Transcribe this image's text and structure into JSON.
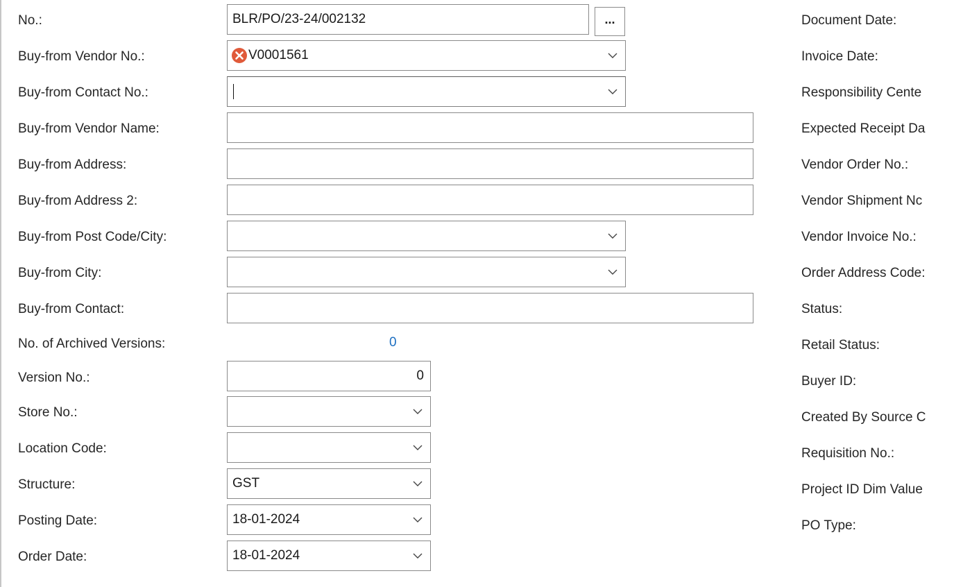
{
  "left_fields": {
    "no": {
      "label": "No.:",
      "value": "BLR/PO/23-24/002132",
      "lookup": "..."
    },
    "buy_from_vendor_no": {
      "label": "Buy-from Vendor No.:",
      "value": "V0001561"
    },
    "buy_from_contact_no": {
      "label": "Buy-from Contact No.:",
      "value": ""
    },
    "buy_from_vendor_name": {
      "label": "Buy-from Vendor Name:",
      "value": ""
    },
    "buy_from_address": {
      "label": "Buy-from Address:",
      "value": ""
    },
    "buy_from_address_2": {
      "label": "Buy-from Address 2:",
      "value": ""
    },
    "buy_from_post_code_city": {
      "label": "Buy-from Post Code/City:",
      "value": ""
    },
    "buy_from_city": {
      "label": "Buy-from City:",
      "value": ""
    },
    "buy_from_contact": {
      "label": "Buy-from Contact:",
      "value": ""
    },
    "no_of_archived_versions": {
      "label": "No. of Archived Versions:",
      "value": "0"
    },
    "version_no": {
      "label": "Version No.:",
      "value": "0"
    },
    "store_no": {
      "label": "Store No.:",
      "value": ""
    },
    "location_code": {
      "label": "Location Code:",
      "value": ""
    },
    "structure": {
      "label": "Structure:",
      "value": "GST"
    },
    "posting_date": {
      "label": "Posting Date:",
      "value": "18-01-2024"
    },
    "order_date": {
      "label": "Order Date:",
      "value": "18-01-2024"
    }
  },
  "right_labels": [
    "Document Date:",
    "Invoice Date:",
    "Responsibility Cente",
    "Expected Receipt Da",
    "Vendor Order No.:",
    "Vendor Shipment Nc",
    "Vendor Invoice No.:",
    "Order Address Code:",
    "Status:",
    "Retail Status:",
    "Buyer ID:",
    "Created By Source C",
    "Requisition No.:",
    "Project ID Dim Value",
    "PO Type:"
  ],
  "colors": {
    "error_icon": "#e05a3a",
    "link": "#1d6fc1"
  },
  "icons": {
    "error": "error-x-icon",
    "dropdown": "chevron-down-icon"
  }
}
